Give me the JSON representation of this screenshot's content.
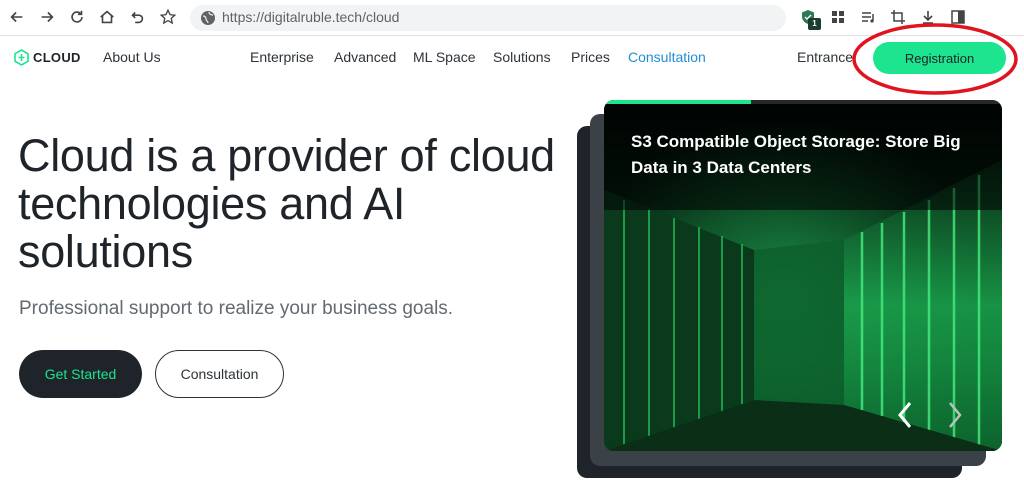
{
  "browser": {
    "url": "https://digitalruble.tech/cloud",
    "extension_badge": "1",
    "icons": [
      "back-icon",
      "forward-icon",
      "reload-icon",
      "home-icon",
      "undo-icon",
      "star-icon",
      "site-info-icon",
      "shield-extension-icon",
      "grid-extension-icon",
      "playlist-icon",
      "crop-icon",
      "download-icon",
      "sidebar-icon"
    ]
  },
  "header": {
    "logo_text": "CLOUD",
    "nav": [
      {
        "label": "About Us"
      },
      {
        "label": "Enterprise"
      },
      {
        "label": "Advanced"
      },
      {
        "label": "ML Space"
      },
      {
        "label": "Solutions"
      },
      {
        "label": "Prices"
      },
      {
        "label": "Consultation",
        "active": true
      },
      {
        "label": "Entrance"
      }
    ],
    "register_label": "Registration"
  },
  "hero": {
    "title": "Cloud is a provider of cloud technologies and AI solutions",
    "subtitle": "Professional support to realize your business goals.",
    "primary_button": "Get Started",
    "secondary_button": "Consultation"
  },
  "card": {
    "title": "S3 Compatible Object Storage: Store Big Data in 3 Data Centers",
    "slide_progress": 0.37
  },
  "colors": {
    "accent_green": "#1ce48f",
    "dark": "#1e2429",
    "link_blue": "#1e8fd6",
    "annotation_red": "#e0141e"
  }
}
